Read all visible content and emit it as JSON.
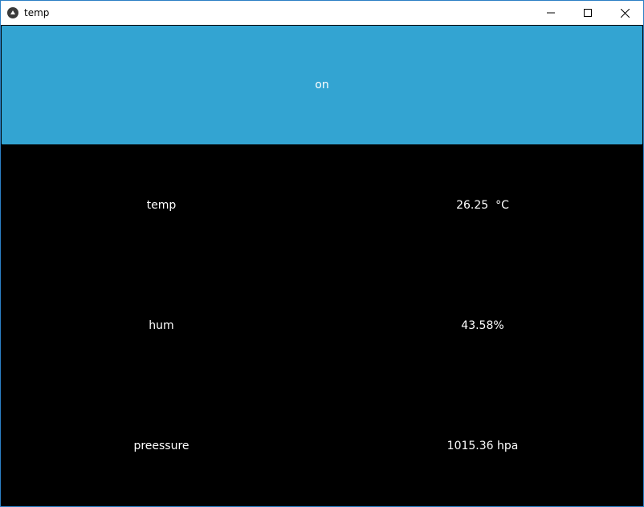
{
  "window": {
    "title": "temp",
    "app_icon": "kivy-icon",
    "controls": [
      "minimize-icon",
      "maximize-icon",
      "close-icon"
    ]
  },
  "toggle": {
    "label": "on",
    "color": "#33a4d2"
  },
  "readings": [
    {
      "label": "temp",
      "value": "26.25  °C"
    },
    {
      "label": "hum",
      "value": "43.58%"
    },
    {
      "label": "preessure",
      "value": "1015.36 hpa"
    }
  ]
}
